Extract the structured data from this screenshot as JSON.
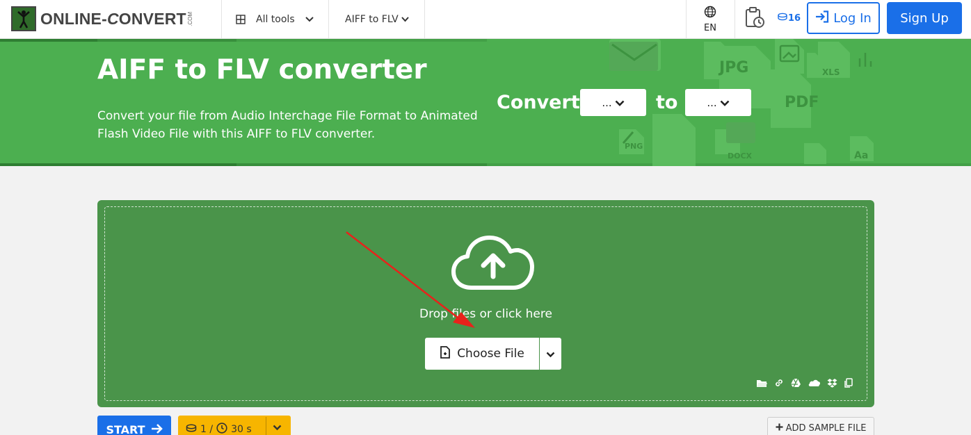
{
  "header": {
    "logo_text_a": "ONLINE-",
    "logo_text_c": "C",
    "logo_text_b": "ONVERT",
    "logo_com": ".COM",
    "all_tools_label": "All tools",
    "converter_menu_label": "AIFF to FLV",
    "language": "EN",
    "credits": "16",
    "login_label": "Log In",
    "signup_label": "Sign Up"
  },
  "hero": {
    "title": "AIFF to FLV converter",
    "description": "Convert your file from Audio Interchage File Format to Animated Flash Video File with this AIFF to FLV converter.",
    "convert_label": "Convert",
    "to_label": "to",
    "from_format": "...",
    "to_format": "..."
  },
  "upload": {
    "drop_text": "Drop files or click here",
    "choose_label": "Choose File"
  },
  "actions": {
    "start_label": "START",
    "cost_count": "1 /",
    "cost_time": "30 s",
    "sample_label": "ADD SAMPLE FILE"
  },
  "colors": {
    "brand_green": "#4caf50",
    "drop_green": "#4a944a",
    "primary_blue": "#1a6fe8",
    "cost_yellow": "#f7b500",
    "annotation_red": "#e8221b"
  }
}
